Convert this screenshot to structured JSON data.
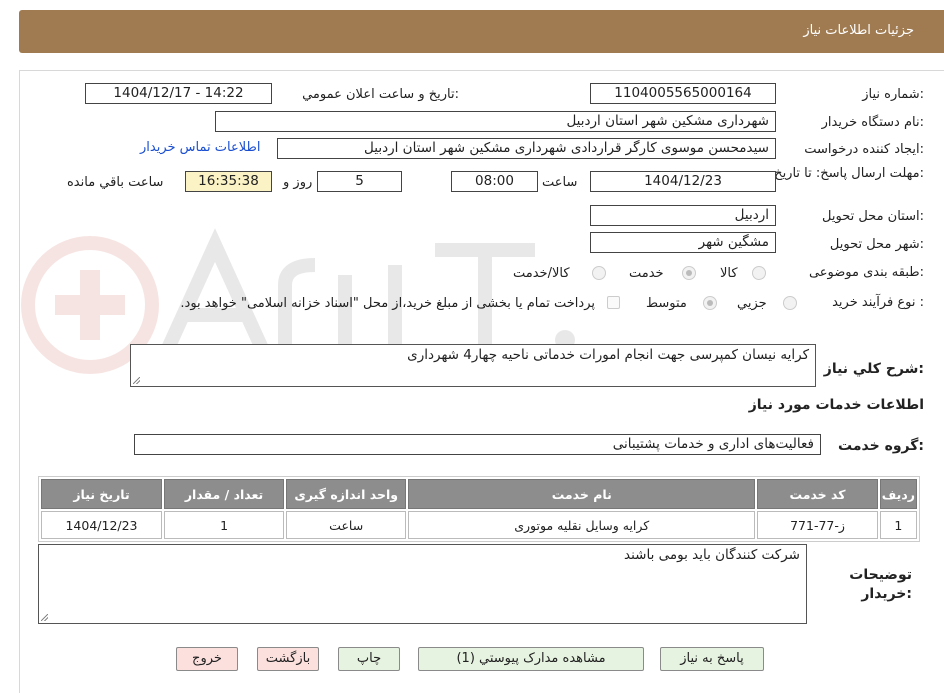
{
  "header": {
    "title": "جزئیات اطلاعات نیاز"
  },
  "fields": {
    "need_number_label": "شماره نیاز:",
    "need_number": "1104005565000164",
    "announce_label": "تاریخ و ساعت اعلان عمومي:",
    "announce_value": "1404/12/17 - 14:22",
    "buyer_label": "نام دستگاه خریدار:",
    "buyer_value": "شهرداری مشکین شهر استان اردبیل",
    "creator_label": "ایجاد کننده درخواست:",
    "creator_value": "سیدمحسن موسوی کارگر قراردادی شهرداری مشکین شهر استان اردبیل",
    "contact_link": "اطلاعات تماس خریدار",
    "deadline_label": "مهلت ارسال پاسخ: تا تاریخ:",
    "deadline_date": "1404/12/23",
    "hour_label": "ساعت",
    "deadline_time": "08:00",
    "days_value": "5",
    "days_label": "روز و",
    "remaining_time": "16:35:38",
    "remaining_label": "ساعت باقي مانده",
    "province_label": "استان محل تحویل:",
    "province_value": "اردبیل",
    "city_label": "شهر محل تحویل:",
    "city_value": "مشگین شهر",
    "category_label": "طبقه بندی موضوعی:",
    "category_options": [
      "کالا",
      "خدمت",
      "کالا/خدمت"
    ],
    "process_label": "نوع فرآیند خرید :",
    "process_options": [
      "جزيي",
      "متوسط"
    ],
    "payment_note": "پرداخت تمام یا بخشی از مبلغ خرید،از محل \"اسناد خزانه اسلامی\" خواهد بود."
  },
  "description": {
    "label": "شرح کلي نیاز:",
    "value": "کرایه نیسان کمپرسی جهت انجام امورات خدماتی ناحیه چهار4 شهرداری"
  },
  "services": {
    "section_title": "اطلاعات خدمات مورد نیاز",
    "group_label": "گروه خدمت:",
    "group_value": "فعالیت‌های اداری و خدمات پشتیبانی",
    "columns": [
      "ردیف",
      "کد خدمت",
      "نام خدمت",
      "واحد اندازه گیری",
      "تعداد / مقدار",
      "تاریخ نیاز"
    ],
    "rows": [
      {
        "row": "1",
        "code": "ز-77-771",
        "name": "کرایه وسایل نقلیه موتوری",
        "unit": "ساعت",
        "qty": "1",
        "date": "1404/12/23"
      }
    ]
  },
  "notes": {
    "label": "توضیحات خریدار:",
    "value": "شرکت کنندگان باید بومی باشند"
  },
  "buttons": {
    "reply": "پاسخ به نیاز",
    "docs": "مشاهده مدارک پیوستي (1)",
    "print": "چاپ",
    "back": "بازگشت",
    "exit": "خروج"
  }
}
